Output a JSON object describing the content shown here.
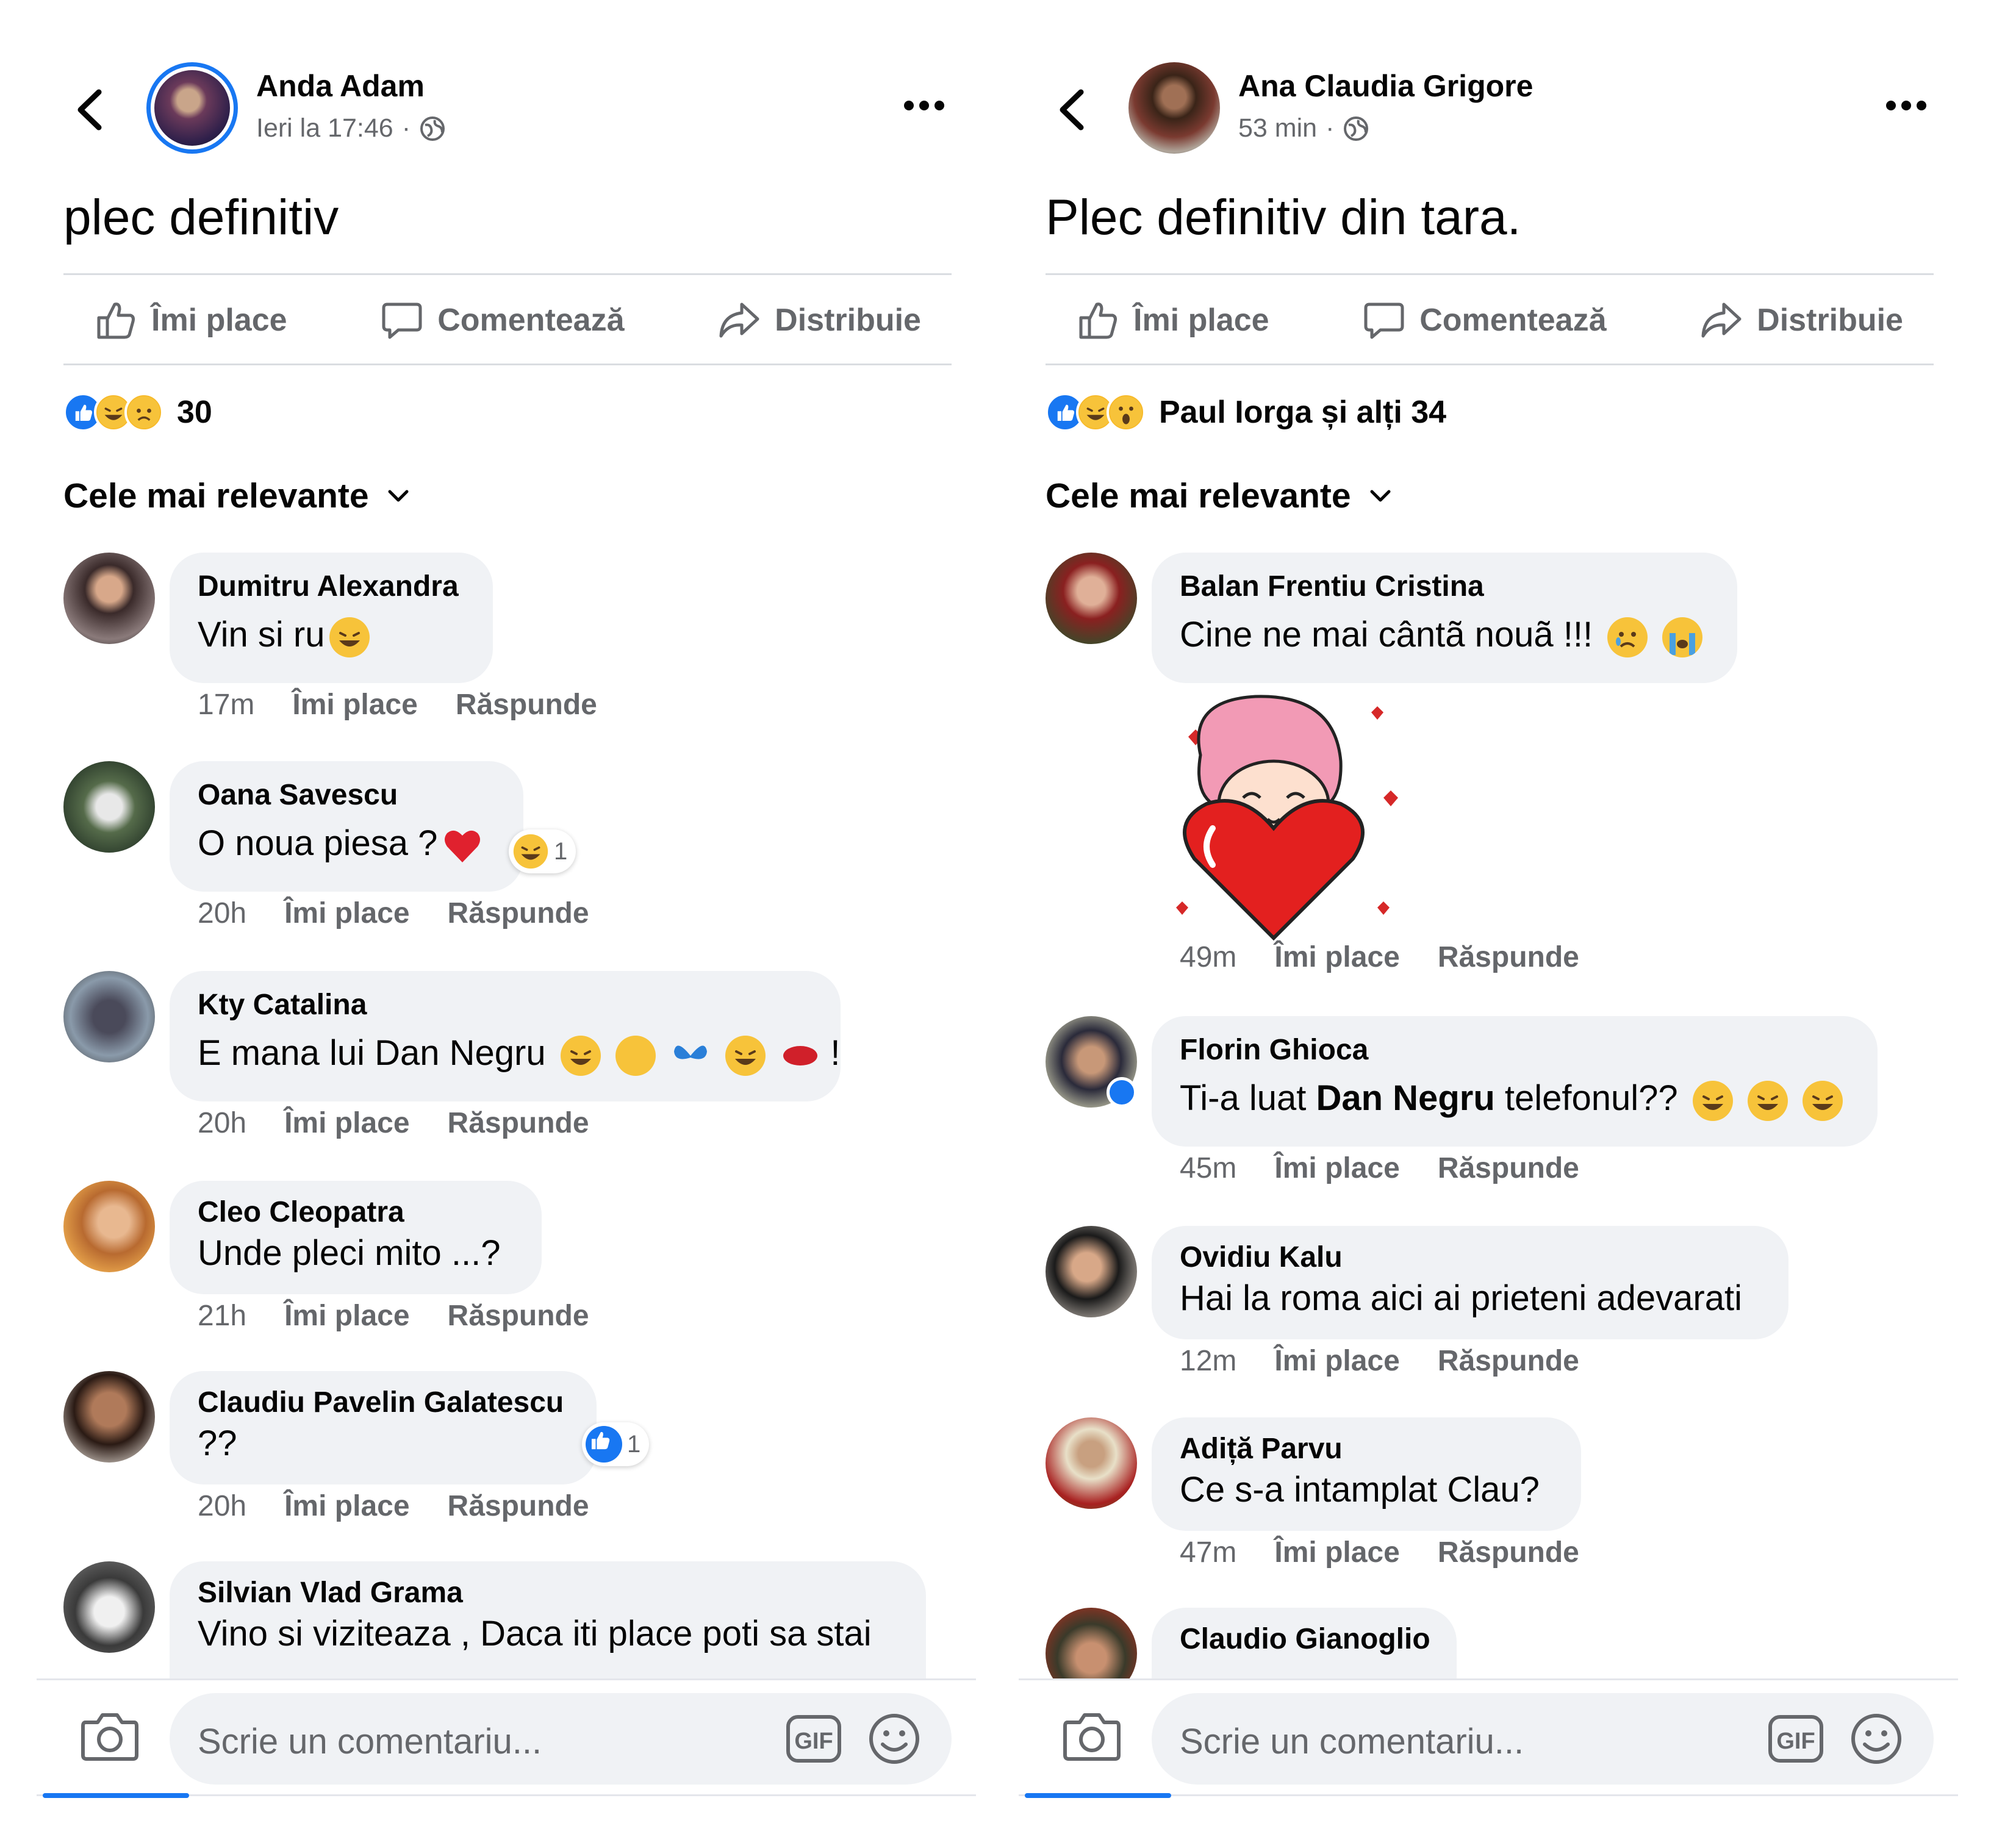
{
  "colors": {
    "accent": "#1877f2",
    "muted": "#65676b",
    "bubble": "#f0f2f5",
    "divider": "#dadde1"
  },
  "left": {
    "author": "Anda Adam",
    "time": "Ieri la 17:46",
    "post_text": "plec definitiv",
    "actions": {
      "like": "Îmi place",
      "comment": "Comentează",
      "share": "Distribuie"
    },
    "reaction_count": "30",
    "sort_label": "Cele mai relevante",
    "comments": [
      {
        "name": "Dumitru Alexandra",
        "text": "Vin si ru",
        "time": "17m",
        "like": "Îmi place",
        "reply": "Răspunde"
      },
      {
        "name": "Oana Savescu",
        "text": "O noua piesa ?",
        "time": "20h",
        "like": "Îmi place",
        "reply": "Răspunde",
        "reaction_count": "1"
      },
      {
        "name": "Kty Catalina",
        "text": "E mana lui Dan Negru",
        "text_after": "!",
        "time": "20h",
        "like": "Îmi place",
        "reply": "Răspunde"
      },
      {
        "name": "Cleo Cleopatra",
        "text": "Unde pleci mito ...?",
        "time": "21h",
        "like": "Îmi place",
        "reply": "Răspunde"
      },
      {
        "name": "Claudiu Pavelin Galatescu",
        "text": "??",
        "time": "20h",
        "like": "Îmi place",
        "reply": "Răspunde",
        "reaction_count": "1"
      },
      {
        "name": "Silvian Vlad Grama",
        "text": "Vino si viziteaza , Daca iti place poti sa stai"
      }
    ],
    "composer_placeholder": "Scrie un comentariu...",
    "gif_label": "GIF"
  },
  "right": {
    "author": "Ana Claudia Grigore",
    "time": "53 min",
    "post_text": "Plec definitiv din tara.",
    "actions": {
      "like": "Îmi place",
      "comment": "Comentează",
      "share": "Distribuie"
    },
    "reaction_summary": "Paul Iorga și alți 34",
    "sort_label": "Cele mai relevante",
    "comments": [
      {
        "name": "Balan Frentiu Cristina",
        "text": "Cine ne mai cântã nouã !!!",
        "time": "49m",
        "like": "Îmi place",
        "reply": "Răspunde"
      },
      {
        "name": "Florin Ghioca",
        "text_pre": "Ti-a luat ",
        "text_bold": "Dan Negru",
        "text_post": " telefonul??",
        "time": "45m",
        "like": "Îmi place",
        "reply": "Răspunde"
      },
      {
        "name": "Ovidiu Kalu",
        "text": "Hai la roma aici ai prieteni adevarati",
        "time": "12m",
        "like": "Îmi place",
        "reply": "Răspunde"
      },
      {
        "name": "Adiță Parvu",
        "text": "Ce s-a intamplat Clau?",
        "time": "47m",
        "like": "Îmi place",
        "reply": "Răspunde"
      },
      {
        "name": "Claudio Gianoglio"
      }
    ],
    "composer_placeholder": "Scrie un comentariu...",
    "gif_label": "GIF"
  }
}
